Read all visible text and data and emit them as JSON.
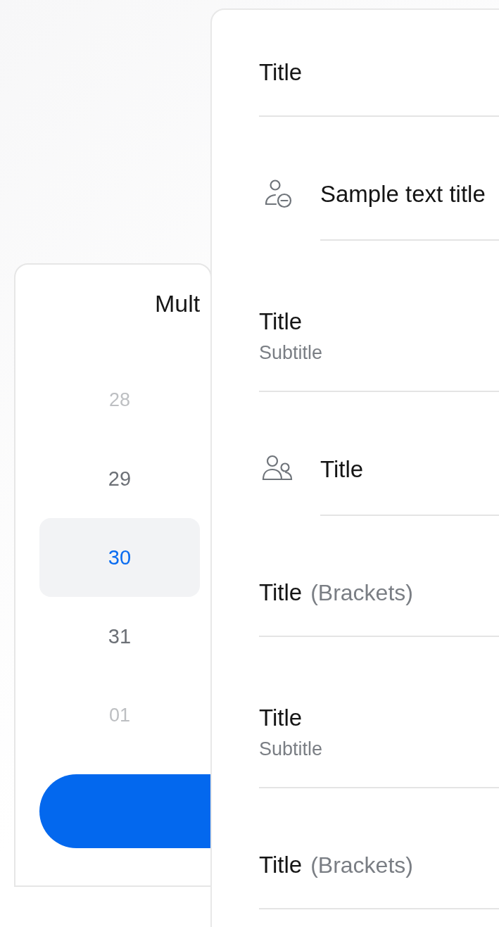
{
  "picker": {
    "title": "Mult",
    "items": [
      {
        "label": "28",
        "selected": false
      },
      {
        "label": "29",
        "selected": false
      },
      {
        "label": "30",
        "selected": true
      },
      {
        "label": "31",
        "selected": false
      },
      {
        "label": "01",
        "selected": false
      }
    ]
  },
  "list": {
    "rows": [
      {
        "kind": "plain",
        "title": "Title"
      },
      {
        "kind": "remove-user",
        "title": "Sample text title"
      },
      {
        "kind": "subtitle",
        "title": "Title",
        "subtitle": "Subtitle"
      },
      {
        "kind": "group",
        "title": "Title"
      },
      {
        "kind": "brackets",
        "title": "Title",
        "note": "(Brackets)"
      },
      {
        "kind": "subtitle",
        "title": "Title",
        "subtitle": "Subtitle"
      },
      {
        "kind": "brackets",
        "title": "Title",
        "note": "(Brackets)"
      }
    ]
  }
}
